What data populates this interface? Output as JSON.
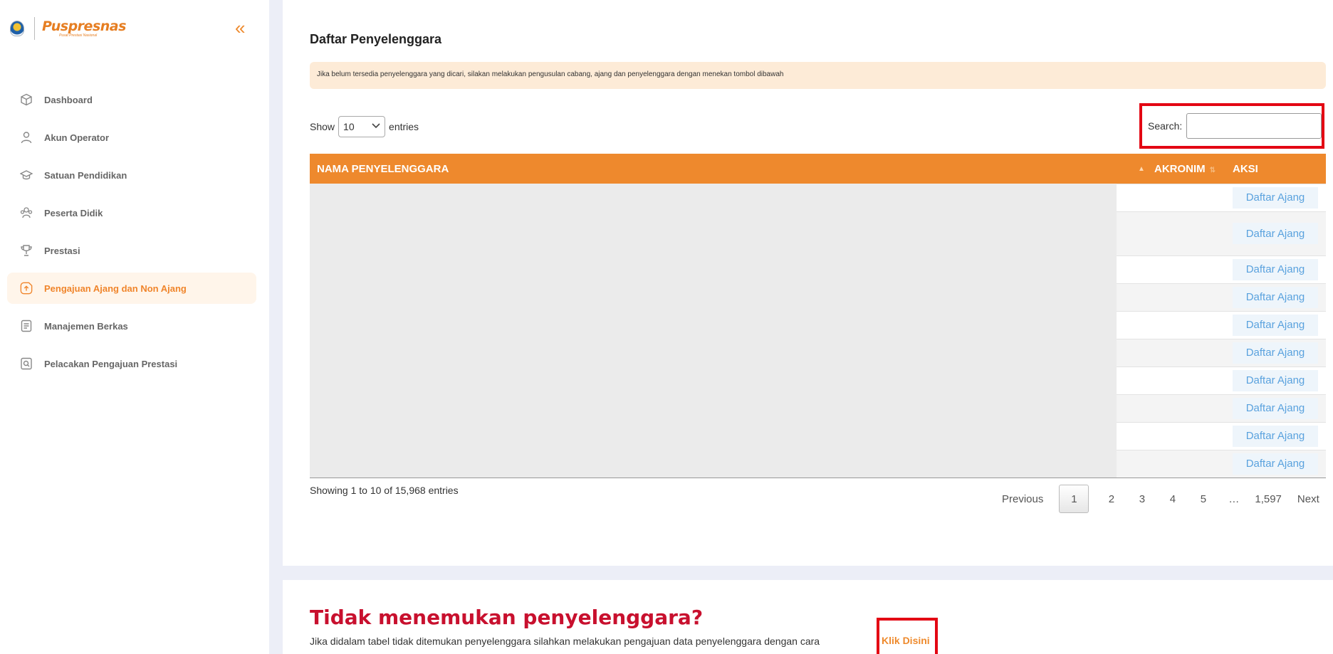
{
  "sidebar": {
    "logo_text": "Puspresnas",
    "logo_subtext": "Pusat Prestasi Nasional",
    "collapse_icon": "«",
    "items": [
      {
        "label": "Dashboard",
        "icon": "cube-icon"
      },
      {
        "label": "Akun Operator",
        "icon": "user-icon"
      },
      {
        "label": "Satuan Pendidikan",
        "icon": "graduation-cap-icon"
      },
      {
        "label": "Peserta Didik",
        "icon": "users-icon"
      },
      {
        "label": "Prestasi",
        "icon": "trophy-icon"
      },
      {
        "label": "Pengajuan Ajang dan Non Ajang",
        "icon": "upload-doc-icon",
        "active": true
      },
      {
        "label": "Manajemen Berkas",
        "icon": "file-icon"
      },
      {
        "label": "Pelacakan Pengajuan Prestasi",
        "icon": "search-doc-icon"
      }
    ]
  },
  "main": {
    "title": "Daftar Penyelenggara",
    "alert": "Jika belum tersedia penyelenggara yang dicari, silakan melakukan pengusulan cabang, ajang dan penyelenggara dengan menekan tombol dibawah",
    "show_label": "Show",
    "entries_value": "10",
    "entries_label": "entries",
    "search_label": "Search:",
    "search_value": ""
  },
  "table": {
    "columns": [
      "NAMA PENYELENGGARA",
      "AKRONIM",
      "AKSI"
    ],
    "action_label": "Daftar Ajang",
    "row_count": 10
  },
  "footer": {
    "info": "Showing 1 to 10 of 15,968 entries",
    "previous": "Previous",
    "pages": [
      "1",
      "2",
      "3",
      "4",
      "5",
      "…",
      "1,597"
    ],
    "current_page": "1",
    "next": "Next"
  },
  "not_found": {
    "title": "Tidak menemukan penyelenggara?",
    "text": "Jika didalam tabel tidak ditemukan penyelenggara silahkan melakukan pengajuan data penyelenggara dengan cara",
    "link": "Klik Disini"
  },
  "colors": {
    "accent": "#ee892d",
    "highlight": "#e30613",
    "link_blue": "#5aa2de",
    "title_red": "#c8102e"
  }
}
